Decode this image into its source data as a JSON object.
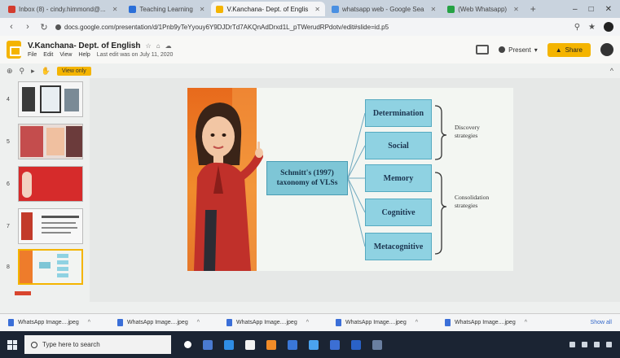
{
  "browser": {
    "tabs": [
      {
        "label": "Inbox (8) - cindy.himmond@...",
        "color": "#d33c2f",
        "active": false
      },
      {
        "label": "Teaching Learning",
        "color": "#2b6fd8",
        "active": false
      },
      {
        "label": "V.Kanchana- Dept. of Englis",
        "color": "#f4b400",
        "active": true
      },
      {
        "label": "whatsapp web - Google Sea",
        "color": "#4a90e2",
        "active": false
      },
      {
        "label": "(Web Whatsapp)",
        "color": "#25a244",
        "active": false
      }
    ],
    "new_tab": "+",
    "url": "docs.google.com/presentation/d/1Pnb9yTeYyouy6Y9DJDrTd7AKQnAdDrxd1L_pTWerudRPdotv/edit#slide=id.p5"
  },
  "app": {
    "title": "V.Kanchana- Dept. of English",
    "menu": [
      "File",
      "Edit",
      "View",
      "Help"
    ],
    "last_edit": "Last edit was on July 11, 2020",
    "present_label": "Present",
    "share_label": "Share",
    "view_only_label": "View only"
  },
  "filmstrip": {
    "slides": [
      {
        "num": "4"
      },
      {
        "num": "5"
      },
      {
        "num": "6"
      },
      {
        "num": "7"
      },
      {
        "num": "8"
      }
    ]
  },
  "slide": {
    "center_title": "Schmitt's (1997)\ntaxonomy of VLSs",
    "categories": [
      "Determination",
      "Social",
      "Memory",
      "Cognitive",
      "Metacognitive"
    ],
    "group_labels": [
      {
        "text": "Discovery strategies",
        "spans": "Determination–Social"
      },
      {
        "text": "Consolidation strategies",
        "spans": "Memory–Metacognitive"
      }
    ]
  },
  "downloads": {
    "items": [
      "WhatsApp Image....jpeg",
      "WhatsApp Image....jpeg",
      "WhatsApp Image....jpeg",
      "WhatsApp Image....jpeg",
      "WhatsApp Image....jpeg"
    ],
    "show_all": "Show all"
  },
  "taskbar": {
    "search_placeholder": "Type here to search",
    "app_colors": [
      "#ffffff",
      "#4a7bd1",
      "#2f8de4",
      "#f2f2f2",
      "#f28c28",
      "#3a77d8",
      "#4aa3f0",
      "#3c6fd4",
      "#2a62c8",
      "#6a7fa0"
    ]
  }
}
